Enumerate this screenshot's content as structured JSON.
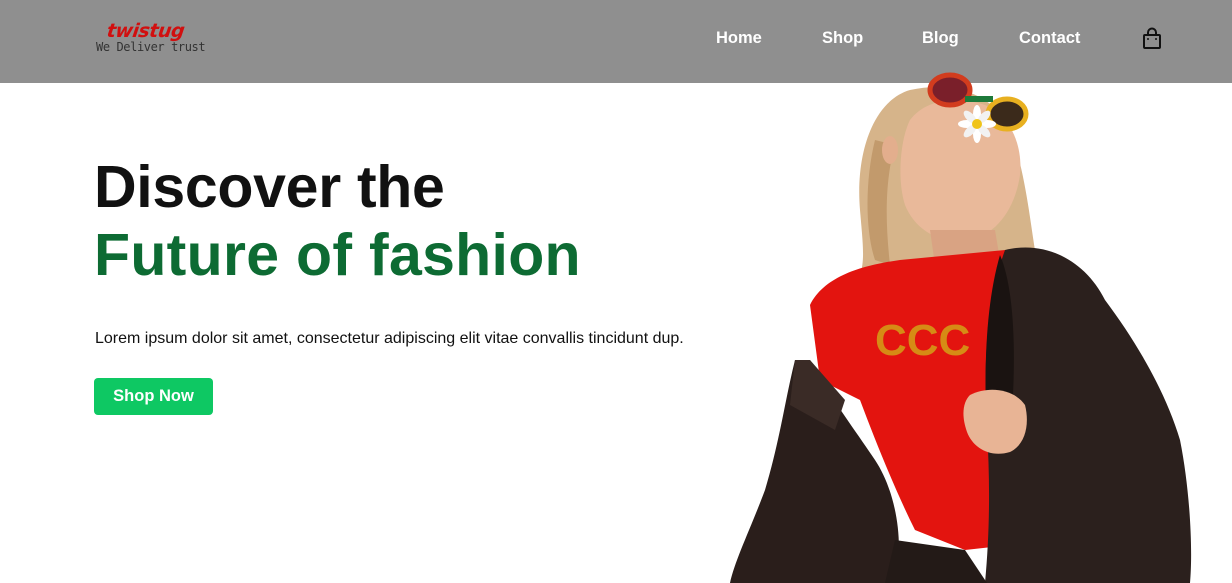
{
  "brand": {
    "name": "twistug",
    "tagline": "We Deliver trust",
    "accent_color": "#d10f0f"
  },
  "nav": {
    "items": [
      {
        "label": "Home"
      },
      {
        "label": "Shop"
      },
      {
        "label": "Blog"
      },
      {
        "label": "Contact"
      }
    ],
    "cart_icon": "shopping-bag-icon"
  },
  "hero": {
    "title_line1": "Discover the",
    "title_line2": "Future of fashion",
    "title_line2_color": "#0d6b33",
    "description": "Lorem ipsum dolor sit amet, consectetur adipiscing elit vitae convallis tincidunt dup.",
    "cta_label": "Shop Now",
    "cta_color": "#0ec863",
    "image": "fashion-model-photo"
  },
  "colors": {
    "header_bg": "#8f8f8f",
    "page_bg": "#ffffff"
  }
}
